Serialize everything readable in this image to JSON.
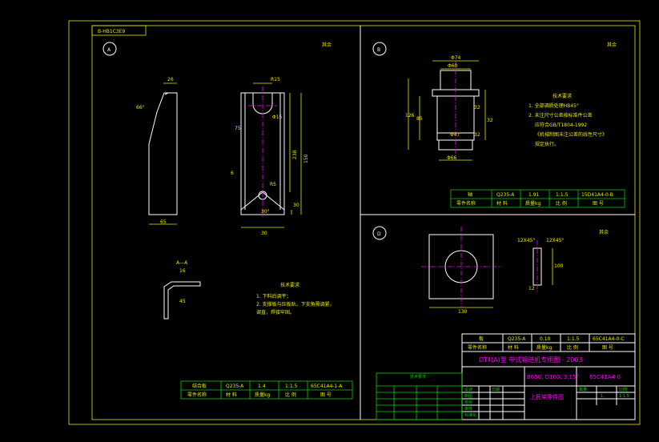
{
  "sheet": {
    "code_box": "B-HB1C3E9",
    "view_a_label": "A",
    "view_b_label": "B",
    "view_d_label": "D",
    "roughness_a": "其余",
    "roughness_b": "其余",
    "roughness_d": "其余"
  },
  "dims": {
    "a_top": "26",
    "a_angle": "66°",
    "a_bottom": "65",
    "a_slot": "R15",
    "a_hole": "Φ15",
    "a_len": "238",
    "a_depth": "150",
    "a_r": "R5",
    "a_foot": "30",
    "a_w": "30",
    "a_w2": "75",
    "a_angle2": "30°",
    "a_small": "6",
    "a_sec": "A—A",
    "a_sec_w": "16",
    "a_sec_a": "45",
    "b_top": "Φ74",
    "b_head": "Φ60",
    "b_h": "126",
    "b_h2": "85",
    "b_c1": "32",
    "b_c2": "32",
    "b_shaft": "Φ47",
    "b_bot": "Φ66",
    "b_h3": "32",
    "d_w": "100",
    "d_pos": "130",
    "d_hole": "12",
    "d_r1": "12X45°",
    "d_r2": "12X45°"
  },
  "tech_a": {
    "title": "技术要求",
    "line1": "1. 下料后调平；",
    "line2": "2. 支撑板与压板贴，下支角需调紧，",
    "line3": "   调直，焊接牢固。"
  },
  "tech_b": {
    "title": "技术要求",
    "line1": "1. 全部调质处理HB45°",
    "line2": "2. 未注尺寸公差按标准件公差",
    "line3": "   应符合GB/T1804-1992",
    "line4": "   《机械制图未注公差的线性尺寸》",
    "line5": "   规定执行。"
  },
  "table_a": {
    "r1": [
      "结合板",
      "Q235-A",
      "1.4",
      "1:1.5",
      "65C41A4-1-A"
    ],
    "r2": [
      "零件名称",
      "材 料",
      "质量kg",
      "比 例",
      "图 号"
    ]
  },
  "table_b": {
    "r1": [
      "轴",
      "Q235-A",
      "1.91",
      "1:1.5",
      "15D41A4-0-B"
    ],
    "r2": [
      "零件名称",
      "材 料",
      "质量kg",
      "比 例",
      "图 号"
    ]
  },
  "table_d": {
    "r1": [
      "板",
      "Q235-A",
      "0.10",
      "1:1.5",
      "65C41A4-0-C"
    ],
    "r2": [
      "零件名称",
      "材 料",
      "质量kg",
      "比 例",
      "图 号"
    ]
  },
  "title_block": {
    "main": "DTⅡ(A)型 带式输送机专用图 - 2003",
    "spec": "B650, D160, 3.15°",
    "code": "65C41A4-0",
    "name": "上托架零件图",
    "scale": "1:1.5",
    "notes_title": "技术要求",
    "cells": [
      "设计",
      "制图",
      "校对",
      "审核",
      "标准化",
      "日期",
      "1:1.5",
      "数量",
      "1",
      "比例"
    ]
  }
}
